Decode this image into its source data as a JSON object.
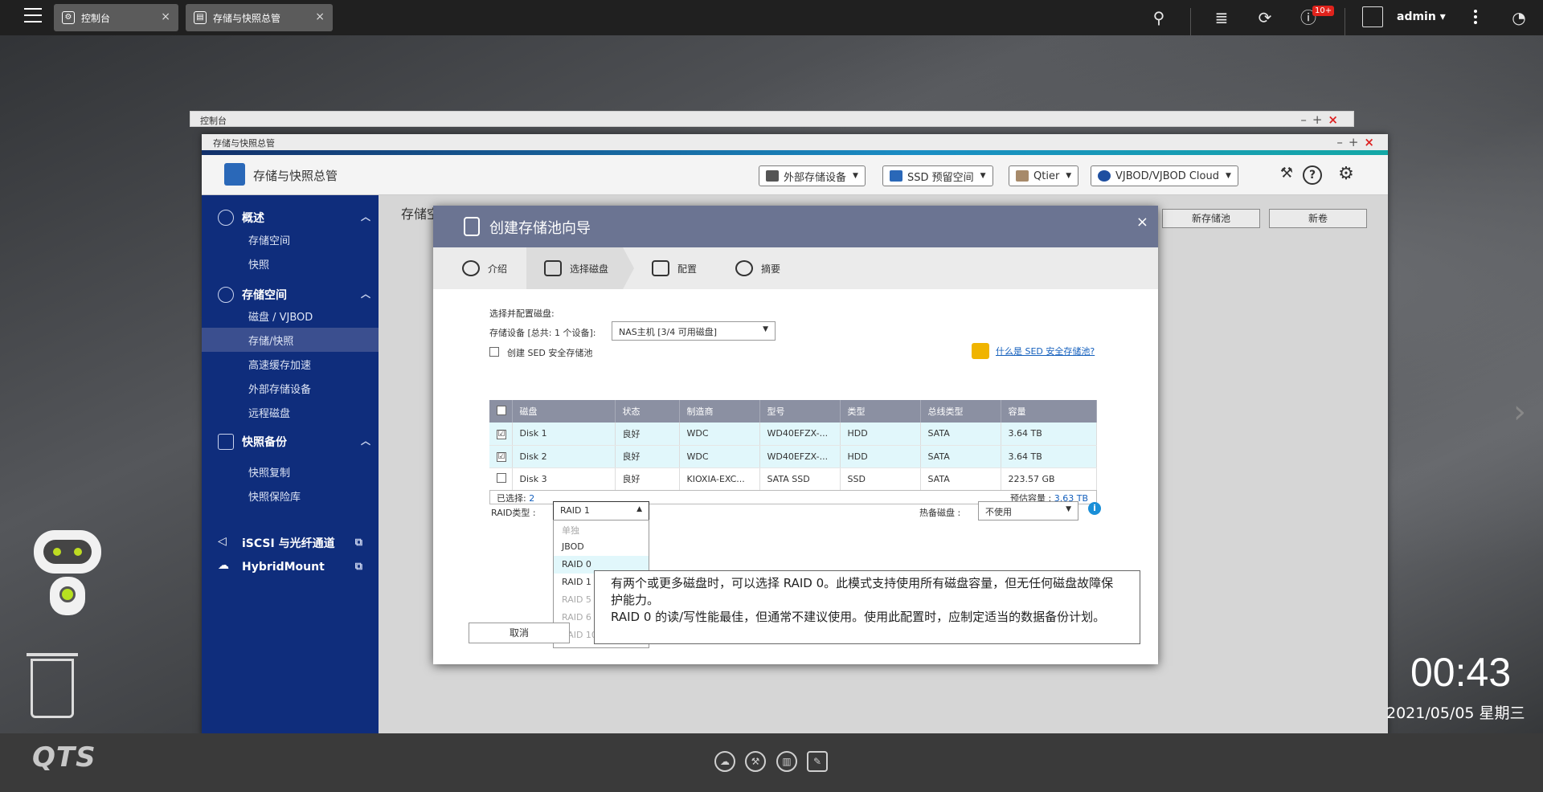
{
  "taskbar": {
    "tabs": [
      {
        "label": "控制台"
      },
      {
        "label": "存储与快照总管"
      }
    ],
    "notification_badge": "10+",
    "user": "admin"
  },
  "console_window": {
    "title": "控制台"
  },
  "storage_window": {
    "title": "存储与快照总管",
    "app_title": "存储与快照总管",
    "header_buttons": [
      "外部存储设备",
      "SSD 预留空间",
      "Qtier",
      "VJBOD/VJBOD Cloud"
    ],
    "help_label": "?",
    "main_title": "存储空",
    "main_buttons": [
      "新存储池",
      "新卷"
    ]
  },
  "sidebar": {
    "sections": [
      {
        "label": "概述",
        "items": [
          "存储空间",
          "快照"
        ]
      },
      {
        "label": "存储空间",
        "items": [
          "磁盘 / VJBOD",
          "存储/快照",
          "高速缓存加速",
          "外部存储设备",
          "远程磁盘"
        ]
      },
      {
        "label": "快照备份",
        "items": [
          "快照复制",
          "快照保险库"
        ]
      }
    ],
    "links": [
      "iSCSI 与光纤通道",
      "HybridMount"
    ],
    "active_item": "存储/快照"
  },
  "wizard": {
    "title": "创建存储池向导",
    "steps": [
      "介绍",
      "选择磁盘",
      "配置",
      "摘要"
    ],
    "active_step": "选择磁盘",
    "section_label": "选择并配置磁盘:",
    "device_label": "存储设备 [总共: 1 个设备]:",
    "device_value": "NAS主机 [3/4 可用磁盘]",
    "sed_checkbox_label": "创建 SED 安全存储池",
    "sed_link": "什么是 SED 安全存储池?",
    "table": {
      "columns": [
        "磁盘",
        "状态",
        "制造商",
        "型号",
        "类型",
        "总线类型",
        "容量"
      ],
      "rows": [
        {
          "checked": "☑",
          "disk": "Disk 1",
          "status": "良好",
          "vendor": "WDC",
          "model": "WD40EFZX-...",
          "type": "HDD",
          "bus": "SATA",
          "capacity": "3.64 TB"
        },
        {
          "checked": "☑",
          "disk": "Disk 2",
          "status": "良好",
          "vendor": "WDC",
          "model": "WD40EFZX-...",
          "type": "HDD",
          "bus": "SATA",
          "capacity": "3.64 TB"
        },
        {
          "checked": "",
          "disk": "Disk 3",
          "status": "良好",
          "vendor": "KIOXIA-EXC...",
          "model": "SATA SSD",
          "type": "SSD",
          "bus": "SATA",
          "capacity": "223.57 GB"
        }
      ],
      "selected_label": "已选择:",
      "selected_count": "2",
      "estimated_label": "预估容量 :",
      "estimated_value": "3.63 TB"
    },
    "raid_label": "RAID类型 :",
    "raid_value": "RAID 1",
    "raid_options": [
      "单独",
      "JBOD",
      "RAID 0",
      "RAID 1",
      "RAID 5",
      "RAID 6",
      "RAID 10"
    ],
    "hot_spare_label": "热备磁盘 :",
    "hot_spare_value": "不使用",
    "cancel": "取消",
    "tooltip_p1": "有两个或更多磁盘时，可以选择 RAID 0。此模式支持使用所有磁盘容量，但无任何磁盘故障保护能力。",
    "tooltip_p2": "RAID 0 的读/写性能最佳，但通常不建议使用。使用此配置时，应制定适当的数据备份计划。"
  },
  "desktop": {
    "logo": "QTS",
    "time": "00:43",
    "date": "2021/05/05 星期三"
  }
}
